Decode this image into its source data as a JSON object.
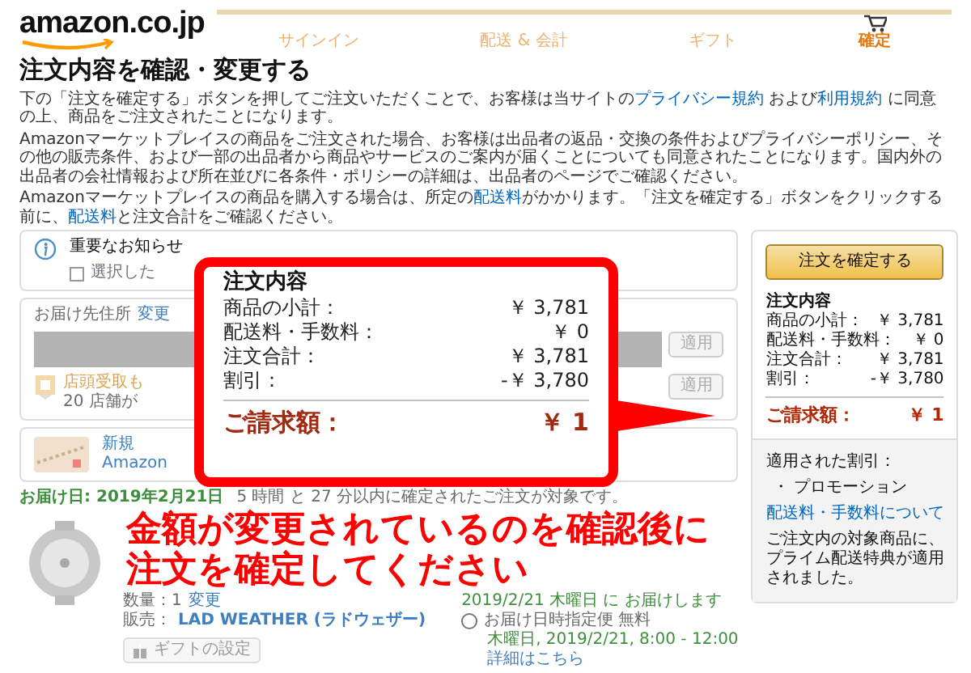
{
  "header": {
    "logo": "amazon.co.jp",
    "steps": [
      {
        "label": "サインイン",
        "selected": false
      },
      {
        "label": "配送 & 会計",
        "selected": false
      },
      {
        "label": "ギフト",
        "selected": false
      },
      {
        "label": "確定",
        "selected": true
      }
    ]
  },
  "title": "注文内容を確認・変更する",
  "paragraphs": [
    [
      {
        "kind": "text",
        "text": "下の「注文を確定する」ボタンを押してご注文いただくことで、お客様は当サイトの"
      },
      {
        "kind": "link",
        "text": "プライバシー規約"
      },
      {
        "kind": "text",
        "text": " および"
      },
      {
        "kind": "link",
        "text": "利用規約"
      },
      {
        "kind": "text",
        "text": " に同意の上、商品をご注文されたことになります。"
      }
    ],
    [
      {
        "kind": "text",
        "text": "Amazonマーケットプレイスの商品をご注文された場合、お客様は出品者の返品・交換の条件およびプライバシーポリシー、その他の販売条件、および一部の出品者から商品やサービスのご案内が届くことについても同意されたことになります。国内外の出品者の会社情報および所在並びに各条件・ポリシーの詳細は、出品者のページでご確認ください。"
      }
    ],
    [
      {
        "kind": "text",
        "text": "Amazonマーケットプレイスの商品を購入する場合は、所定の"
      },
      {
        "kind": "link",
        "text": "配送料"
      },
      {
        "kind": "text",
        "text": "がかかります。「注文を確定する」ボタンをクリックする前に、"
      },
      {
        "kind": "link",
        "text": "配送料"
      },
      {
        "kind": "text",
        "text": "と注文合計をご確認ください。"
      }
    ]
  ],
  "notice": {
    "title": "重要なお知らせ",
    "checkbox": {
      "label": "選択した",
      "checked": false
    }
  },
  "address": {
    "label": "お届け先住所",
    "change": "変更",
    "apply_button": "適用",
    "pickup": {
      "title": "店頭受取も",
      "note": "20 店舗が",
      "apply_button": "適用"
    }
  },
  "payment": {
    "title": "新規",
    "subtitle": "Amazon"
  },
  "delivery": {
    "date": "お届け日: 2019年2月21日",
    "note": "5 時間 と 27 分以内に確定されたご注文が対象です。"
  },
  "item": {
    "quantity": "数量：1",
    "quantity_change": "変更",
    "seller_label": "販売：",
    "seller": "LAD WEATHER (ラドウェザー)",
    "gift_button": "ギフトの設定"
  },
  "shipping": {
    "arrival": "2019/2/21 木曜日 に お届けします",
    "options": [
      {
        "label": "お届け日時指定便 無料",
        "selected": false,
        "detail": "木曜日, 2019/2/21, 8:00 - 12:00",
        "link": "詳細はこちら"
      }
    ]
  },
  "summary": {
    "button": "注文を確定する",
    "heading": "注文内容",
    "rows": [
      {
        "label": "商品の小計：",
        "value": "￥ 3,781"
      },
      {
        "label": "配送料・手数料：",
        "value": "￥ 0"
      },
      {
        "label": "注文合計：",
        "value": "￥ 3,781"
      },
      {
        "label": "割引：",
        "value": "-￥ 3,780"
      }
    ],
    "total": {
      "label": "ご請求額：",
      "value": "￥ 1"
    },
    "discount_label": "適用された割引：",
    "discounts": [
      "・ プロモーション"
    ],
    "shipping_link": "配送料・手数料について",
    "note": "ご注文内の対象商品に、プライム配送特典が適用されました。"
  },
  "callout": {
    "heading": "注文内容",
    "rows": [
      {
        "label": "商品の小計：",
        "value": "￥ 3,781"
      },
      {
        "label": "配送料・手数料：",
        "value": "￥ 0"
      },
      {
        "label": "注文合計：",
        "value": "￥ 3,781"
      },
      {
        "label": "割引：",
        "value": "-￥ 3,780"
      }
    ],
    "total": {
      "label": "ご請求額：",
      "value": "￥ 1"
    }
  },
  "annotation": [
    "金額が変更されているのを確認後に",
    "注文を確定してください"
  ]
}
